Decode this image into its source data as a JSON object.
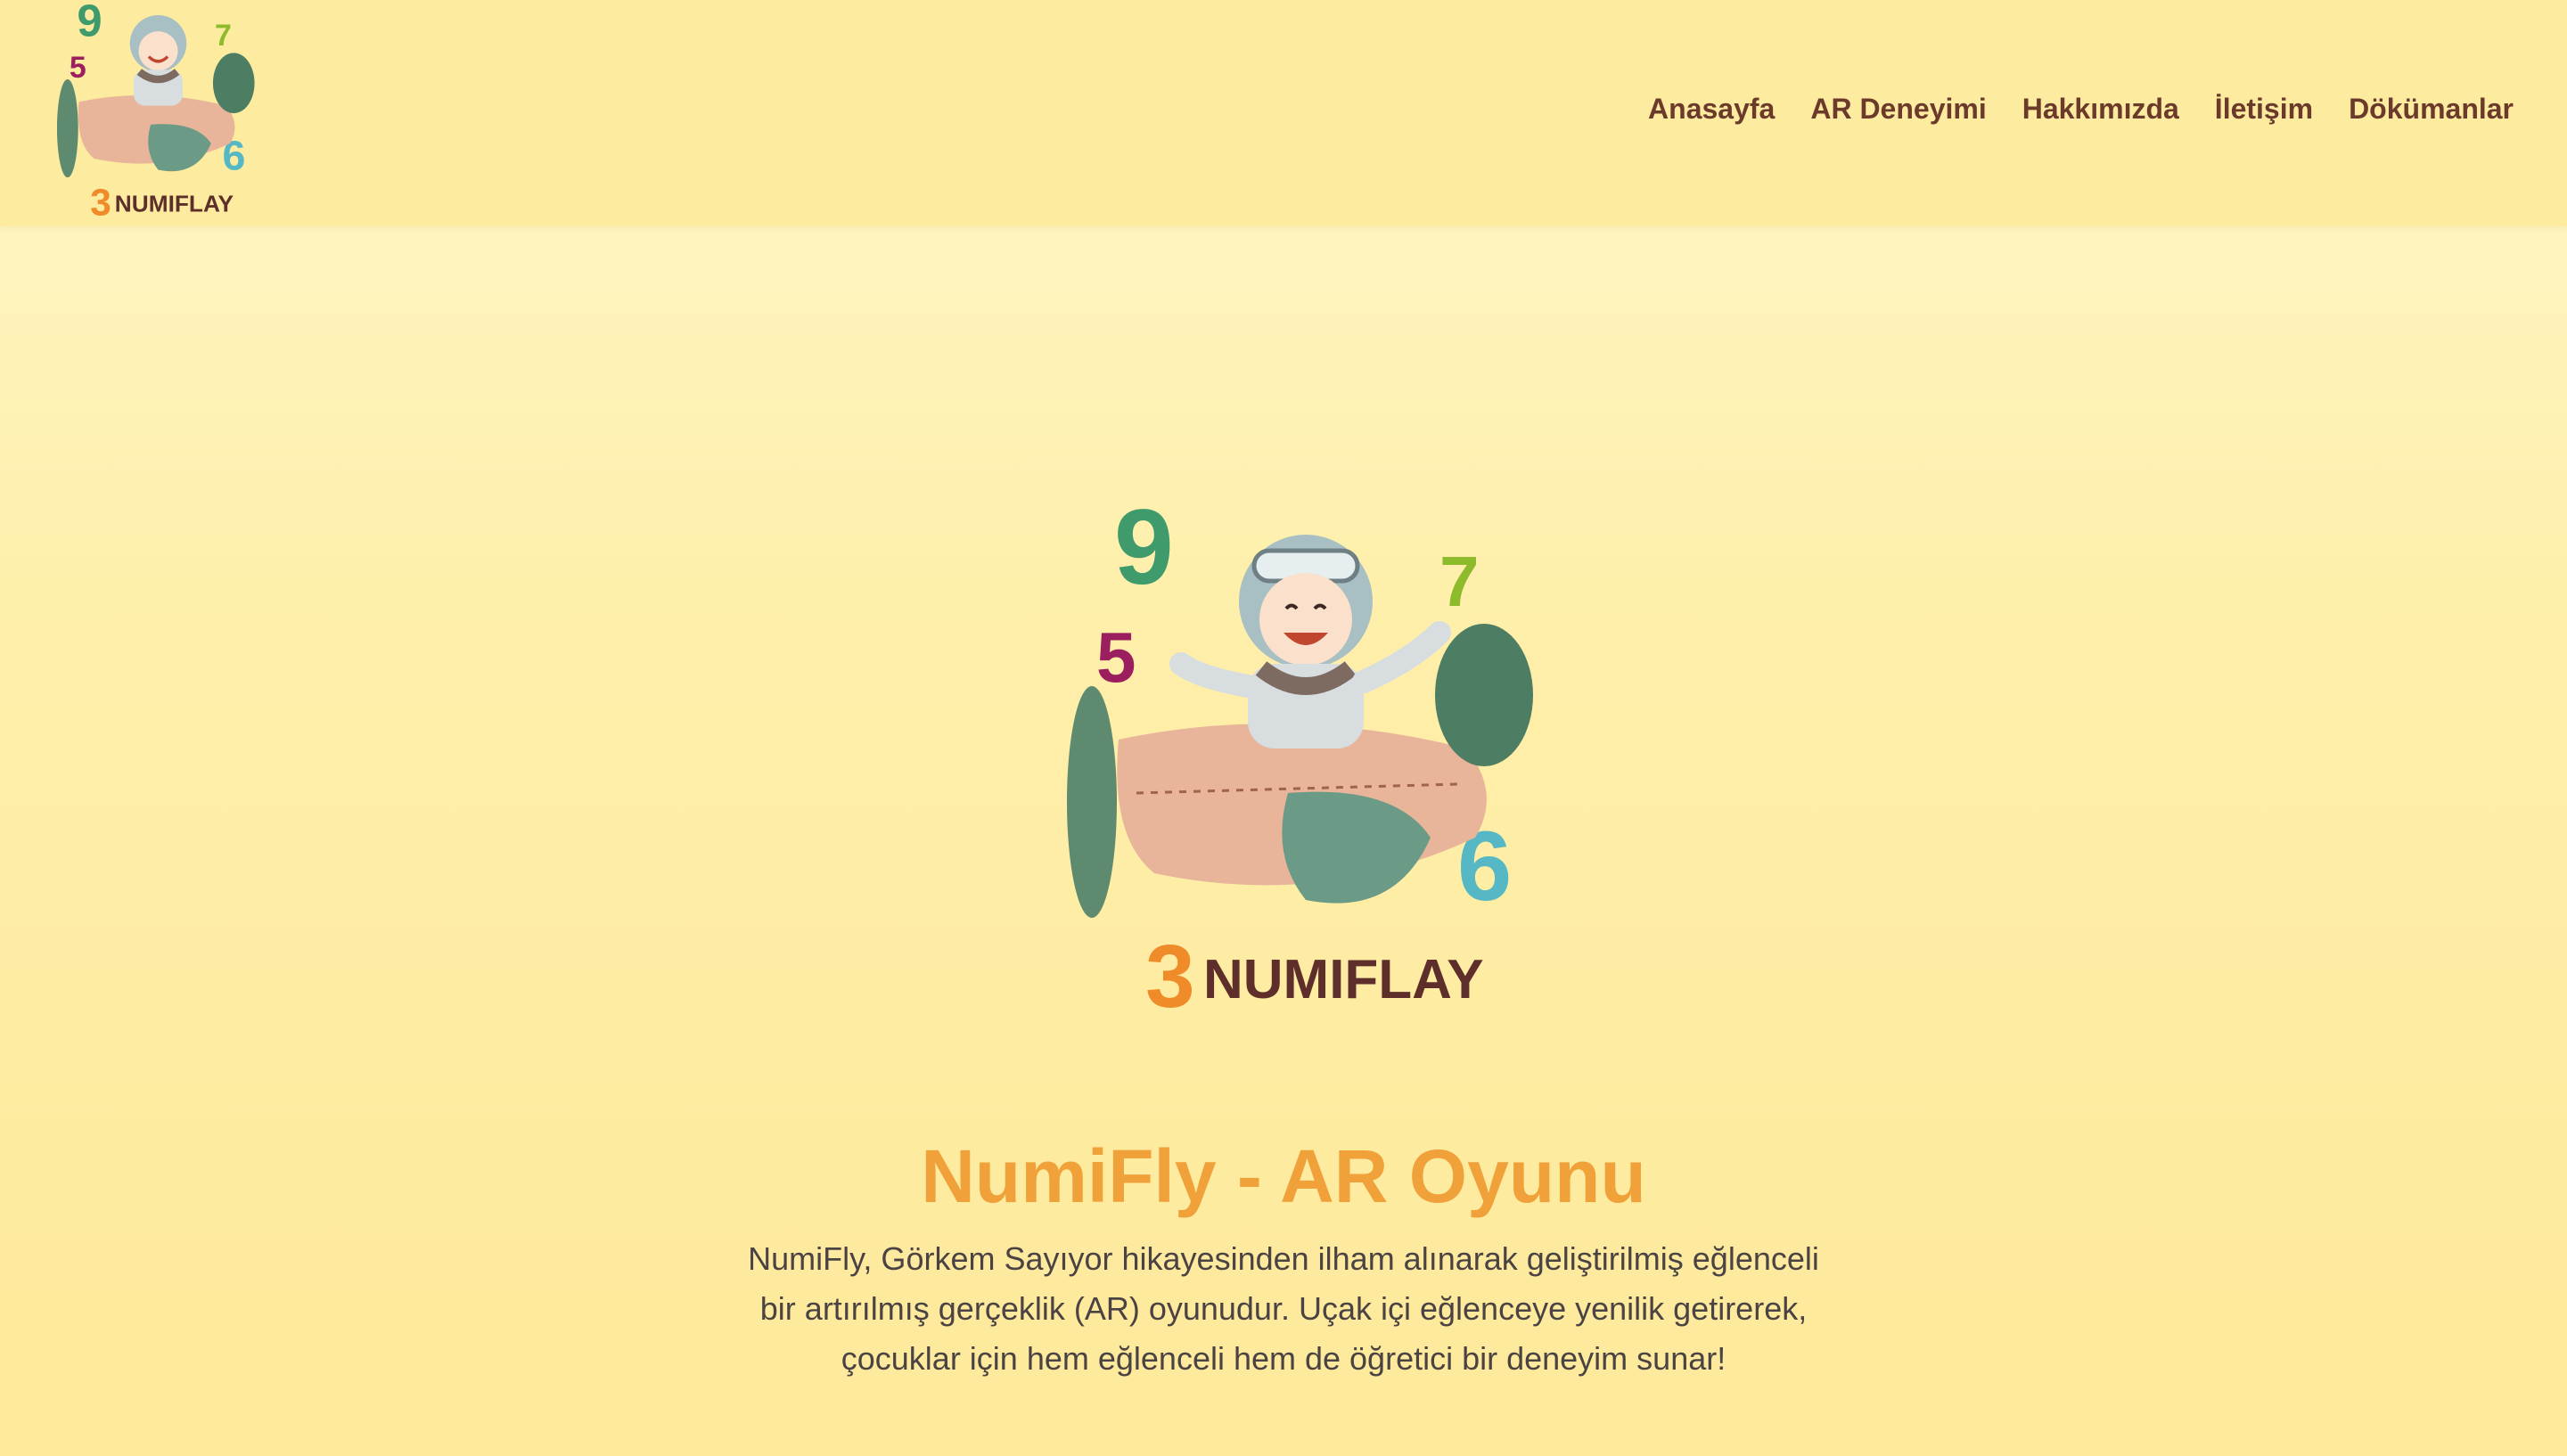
{
  "header": {
    "logo_alt": "NumiFly logo",
    "logo_caption": "NUMIFLAY"
  },
  "nav": {
    "items": [
      {
        "label": "Anasayfa"
      },
      {
        "label": "AR Deneyimi"
      },
      {
        "label": "Hakkımızda"
      },
      {
        "label": "İletişim"
      },
      {
        "label": "Dökümanlar"
      }
    ]
  },
  "hero": {
    "logo_caption": "NUMIFLAY",
    "title": "NumiFly - AR Oyunu",
    "description": "NumiFly, Görkem Sayıyor hikayesinden ilham alınarak geliştirilmiş eğlenceli bir artırılmış gerçeklik (AR) oyunudur. Uçak içi eğlenceye yenilik getirerek, çocuklar için hem eğlenceli hem de öğretici bir deneyim sunar!"
  },
  "colors": {
    "header_bg": "#fdeca0",
    "nav_text": "#6b3a2b",
    "title": "#f0a13a",
    "body_text": "#4b4343"
  }
}
